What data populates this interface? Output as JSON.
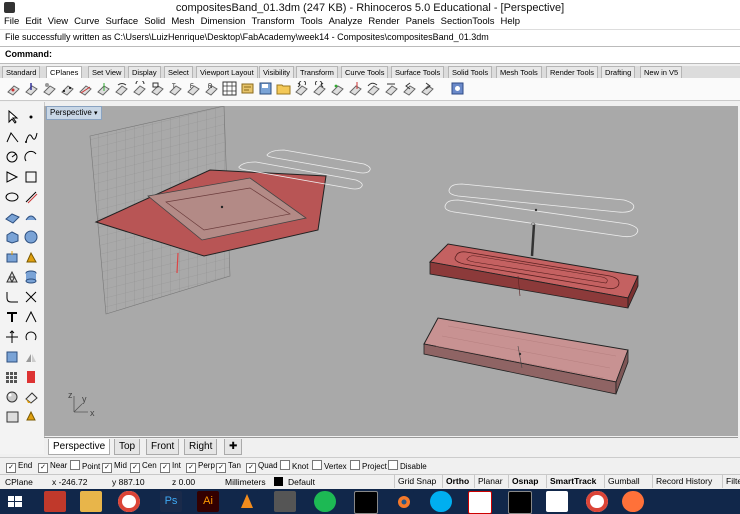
{
  "window": {
    "title": "compositesBand_01.3dm (247 KB) - Rhinoceros 5.0 Educational - [Perspective]"
  },
  "menu": [
    "File",
    "Edit",
    "View",
    "Curve",
    "Surface",
    "Solid",
    "Mesh",
    "Dimension",
    "Transform",
    "Tools",
    "Analyze",
    "Render",
    "Panels",
    "SectionTools",
    "Help"
  ],
  "status_message": "File successfully written as C:\\Users\\LuizHenrique\\Desktop\\FabAcademy\\week14 - Composites\\compositesBand_01.3dm",
  "command": {
    "label": "Command:",
    "value": ""
  },
  "toolbar_tabs": [
    "Standard",
    "CPlanes",
    "Set View",
    "Display",
    "Select",
    "Viewport Layout",
    "Visibility",
    "Transform",
    "Curve Tools",
    "Surface Tools",
    "Solid Tools",
    "Mesh Tools",
    "Render Tools",
    "Drafting",
    "New in V5"
  ],
  "active_toolbar_tab": "CPlanes",
  "viewport": {
    "label": "Perspective",
    "axis_labels": [
      "z",
      "y",
      "x"
    ]
  },
  "viewport_tabs": [
    "Perspective",
    "Top",
    "Front",
    "Right"
  ],
  "active_viewport_tab": "Perspective",
  "osnaps": [
    {
      "label": "End",
      "checked": true
    },
    {
      "label": "Near",
      "checked": true
    },
    {
      "label": "Point",
      "checked": false
    },
    {
      "label": "Mid",
      "checked": true
    },
    {
      "label": "Cen",
      "checked": true
    },
    {
      "label": "Int",
      "checked": true
    },
    {
      "label": "Perp",
      "checked": true
    },
    {
      "label": "Tan",
      "checked": true
    },
    {
      "label": "Quad",
      "checked": true
    },
    {
      "label": "Knot",
      "checked": false
    },
    {
      "label": "Vertex",
      "checked": false
    },
    {
      "label": "Project",
      "checked": false
    },
    {
      "label": "Disable",
      "checked": false
    }
  ],
  "status": {
    "cplane": "CPlane",
    "x": "x -246.72",
    "y": "y 887.10",
    "z": "z 0.00",
    "units": "Millimeters",
    "layer": "Default",
    "buttons": [
      "Grid Snap",
      "Ortho",
      "Planar",
      "Osnap",
      "SmartTrack",
      "Gumball",
      "Record History",
      "Filte"
    ],
    "bold_buttons": [
      "Ortho",
      "Osnap",
      "SmartTrack"
    ]
  },
  "taskbar_apps": [
    "start",
    "solidworks",
    "file-explorer",
    "chrome",
    "photoshop",
    "illustrator",
    "vlc",
    "inkscape",
    "spotify",
    "terminal",
    "blender",
    "skype",
    "eagle",
    "terminal-2",
    "app",
    "chrome-2",
    "firefox"
  ],
  "colors": {
    "viewport_bg": "#a9a9a9",
    "part_red": "#b85555",
    "taskbar": "#11274a"
  }
}
